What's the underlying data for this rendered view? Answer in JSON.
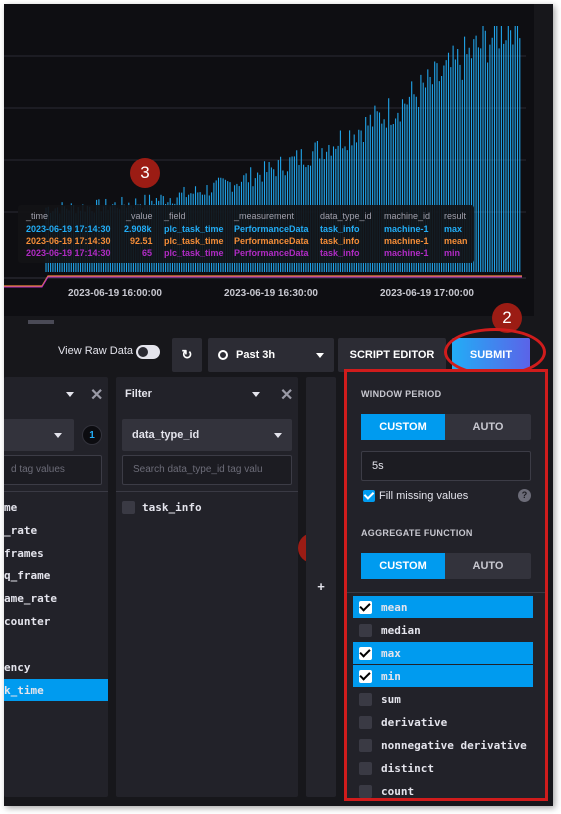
{
  "chart": {
    "x_ticks": [
      "2023-06-19 16:00:00",
      "2023-06-19 16:30:00",
      "2023-06-19 17:00:00"
    ],
    "colors": {
      "bars": "#22adf6",
      "mean": "#f48d38",
      "min": "#b02bc4",
      "background": "#0e0e12"
    }
  },
  "tooltip": {
    "headers": [
      "_time",
      "_value",
      "_field",
      "_measurement",
      "data_type_id",
      "machine_id",
      "result"
    ],
    "rows": [
      {
        "time": "2023-06-19 17:14:30",
        "value": "2.908k",
        "field": "plc_task_time",
        "measurement": "PerformanceData",
        "data_type_id": "task_info",
        "machine_id": "machine-1",
        "result": "max"
      },
      {
        "time": "2023-06-19 17:14:30",
        "value": "92.51",
        "field": "plc_task_time",
        "measurement": "PerformanceData",
        "data_type_id": "task_info",
        "machine_id": "machine-1",
        "result": "mean"
      },
      {
        "time": "2023-06-19 17:14:30",
        "value": "65",
        "field": "plc_task_time",
        "measurement": "PerformanceData",
        "data_type_id": "task_info",
        "machine_id": "machine-1",
        "result": "min"
      }
    ]
  },
  "badges": [
    "1",
    "2",
    "3"
  ],
  "toolbar": {
    "view_raw_label": "View Raw Data",
    "time_range": "Past 3h",
    "script_editor_label": "SCRIPT EDITOR",
    "submit_label": "SUBMIT"
  },
  "left_column": {
    "search_placeholder": "d tag values",
    "count": "1",
    "items": [
      "me",
      "_rate",
      "frames",
      "q_frame",
      "ame_rate",
      "counter",
      "ency",
      "k_time"
    ]
  },
  "filter_column": {
    "title": "Filter",
    "selected_key": "data_type_id",
    "search_placeholder": "Search data_type_id tag valu",
    "values": [
      "task_info"
    ],
    "add_label": "+"
  },
  "aggregate": {
    "window_period_title": "WINDOW PERIOD",
    "custom_label": "CUSTOM",
    "auto_label": "AUTO",
    "window_period_value": "5s",
    "fill_missing_label": "Fill missing values",
    "help_label": "?",
    "aggregate_function_title": "AGGREGATE FUNCTION",
    "functions": [
      {
        "name": "mean",
        "checked": true
      },
      {
        "name": "median",
        "checked": false
      },
      {
        "name": "max",
        "checked": true
      },
      {
        "name": "min",
        "checked": true
      },
      {
        "name": "sum",
        "checked": false
      },
      {
        "name": "derivative",
        "checked": false
      },
      {
        "name": "nonnegative derivative",
        "checked": false
      },
      {
        "name": "distinct",
        "checked": false
      },
      {
        "name": "count",
        "checked": false
      }
    ]
  }
}
